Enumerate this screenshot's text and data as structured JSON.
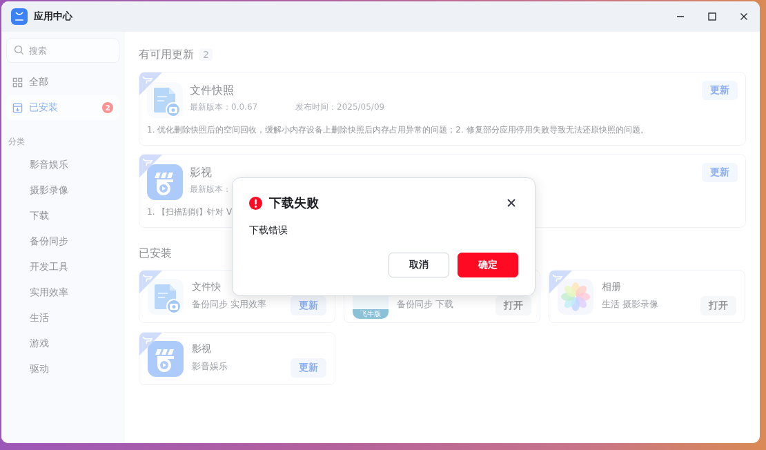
{
  "window": {
    "title": "应用中心"
  },
  "sidebar": {
    "search": {
      "placeholder": "搜索"
    },
    "nav": [
      {
        "label": "全部",
        "selected": false
      },
      {
        "label": "已安装",
        "selected": true,
        "badge": "2"
      }
    ],
    "section_label": "分类",
    "categories": [
      "影音娱乐",
      "摄影录像",
      "下载",
      "备份同步",
      "开发工具",
      "实用效率",
      "生活",
      "游戏",
      "驱动"
    ]
  },
  "updates": {
    "title": "有可用更新",
    "count": "2",
    "items": [
      {
        "name": "文件快照",
        "ribbon": true,
        "version": "最新版本：0.0.67",
        "date": "发布时间：2025/05/09",
        "notes": "1. 优化删除快照后的空间回收，缓解小内存设备上删除快照后内存占用异常的问题；2. 修复部分应用停用失败导致无法还原快照的问题。",
        "button": "更新"
      },
      {
        "name": "影视",
        "ribbon": true,
        "version": "最新版本：",
        "notes": "1. 【扫描刮削】针对 V",
        "button": "更新"
      }
    ]
  },
  "installed": {
    "title": "已安装",
    "items": [
      {
        "name": "文件快",
        "kind": "update",
        "ribbon": true,
        "tags": "备份同步 实用效率",
        "button": "更新"
      },
      {
        "kind": "open",
        "icon_badge": "飞牛版",
        "tags": "备份同步 下载",
        "button": "打开"
      },
      {
        "name": "相册",
        "kind": "open",
        "ribbon": true,
        "tags": "生活 摄影录像",
        "button": "打开"
      },
      {
        "name": "影视",
        "kind": "update",
        "ribbon": true,
        "tags": "影音娱乐",
        "button": "更新"
      }
    ]
  },
  "dialog": {
    "title": "下载失败",
    "message": "下载错误",
    "buttons": [
      {
        "label": "取消",
        "kind": "secondary"
      },
      {
        "label": "确定",
        "kind": "primary"
      }
    ]
  }
}
